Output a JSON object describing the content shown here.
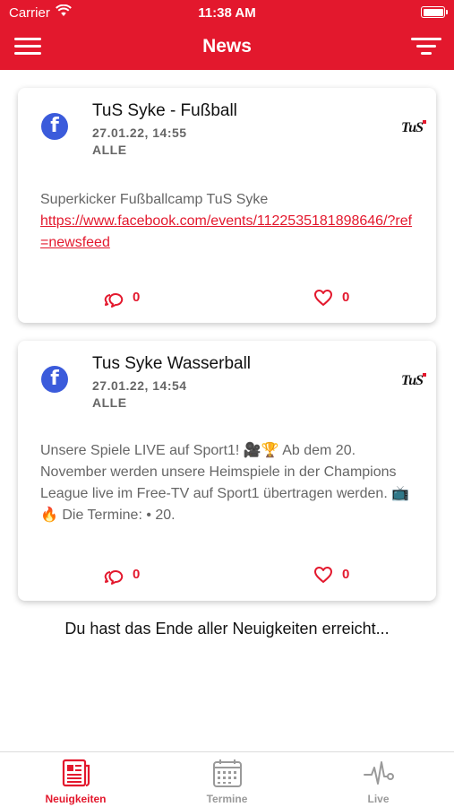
{
  "status_bar": {
    "carrier": "Carrier",
    "time": "11:38 AM"
  },
  "header": {
    "title": "News"
  },
  "posts": [
    {
      "author": "TuS Syke - Fußball",
      "date": "27.01.22, 14:55",
      "category": "ALLE",
      "text": "Superkicker Fußballcamp TuS Syke",
      "link": "https://www.facebook.com/events/1122535181898646/?ref=newsfeed",
      "comments": "0",
      "likes": "0",
      "source_icon": "facebook-icon",
      "club_logo": "TuS"
    },
    {
      "author": "Tus Syke Wasserball",
      "date": "27.01.22, 14:54",
      "category": "ALLE",
      "text": "Unsere Spiele LIVE auf Sport1! 🎥🏆 Ab dem 20. November werden unsere Heimspiele in der Champions League live im Free-TV auf Sport1 übertragen werden. 📺🔥 Die Termine: • 20.",
      "comments": "0",
      "likes": "0",
      "source_icon": "facebook-icon",
      "club_logo": "TuS"
    }
  ],
  "end_message": "Du hast das Ende aller Neuigkeiten erreicht...",
  "tabs": [
    {
      "label": "Neuigkeiten",
      "icon": "newspaper-icon",
      "active": true
    },
    {
      "label": "Termine",
      "icon": "calendar-icon",
      "active": false
    },
    {
      "label": "Live",
      "icon": "pulse-icon",
      "active": false
    }
  ],
  "colors": {
    "accent": "#e3182d",
    "facebook": "#3b5bdb",
    "muted_text": "#666666",
    "inactive_tab": "#9a9a9a"
  }
}
